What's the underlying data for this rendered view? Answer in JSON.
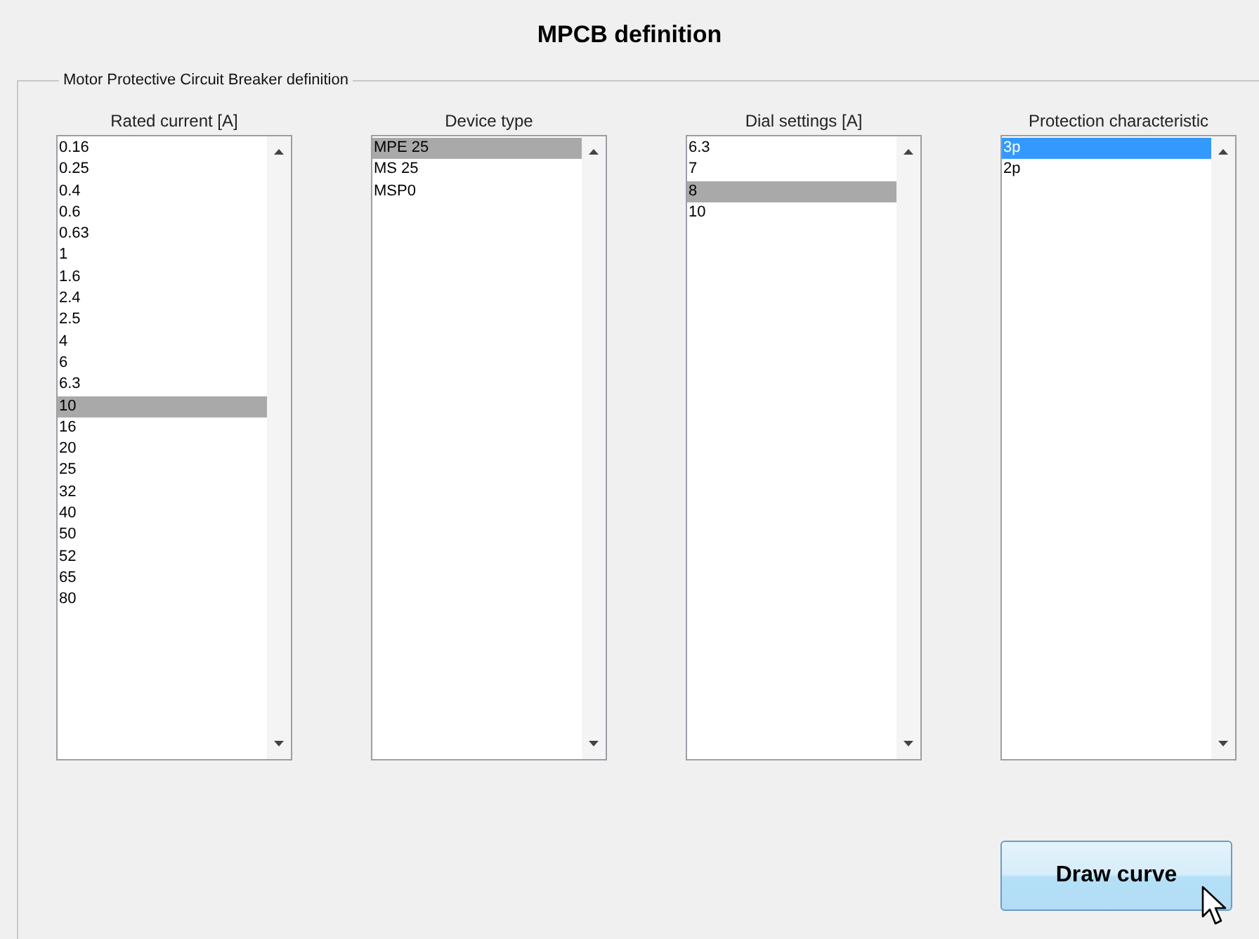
{
  "window": {
    "title": "MPCB definition"
  },
  "group": {
    "title": "Motor Protective Circuit Breaker definition"
  },
  "lists": [
    {
      "label": "Rated current [A]",
      "focused": false,
      "items": [
        {
          "text": "0.16",
          "selected": false
        },
        {
          "text": "0.25",
          "selected": false
        },
        {
          "text": "0.4",
          "selected": false
        },
        {
          "text": "0.6",
          "selected": false
        },
        {
          "text": "0.63",
          "selected": false
        },
        {
          "text": "1",
          "selected": false
        },
        {
          "text": "1.6",
          "selected": false
        },
        {
          "text": "2.4",
          "selected": false
        },
        {
          "text": "2.5",
          "selected": false
        },
        {
          "text": "4",
          "selected": false
        },
        {
          "text": "6",
          "selected": false
        },
        {
          "text": "6.3",
          "selected": false
        },
        {
          "text": "10",
          "selected": true
        },
        {
          "text": "16",
          "selected": false
        },
        {
          "text": "20",
          "selected": false
        },
        {
          "text": "25",
          "selected": false
        },
        {
          "text": "32",
          "selected": false
        },
        {
          "text": "40",
          "selected": false
        },
        {
          "text": "50",
          "selected": false
        },
        {
          "text": "52",
          "selected": false
        },
        {
          "text": "65",
          "selected": false
        },
        {
          "text": "80",
          "selected": false
        }
      ]
    },
    {
      "label": "Device type",
      "focused": false,
      "items": [
        {
          "text": "MPE 25",
          "selected": true
        },
        {
          "text": "MS 25",
          "selected": false
        },
        {
          "text": "MSP0",
          "selected": false
        }
      ]
    },
    {
      "label": "Dial settings [A]",
      "focused": false,
      "items": [
        {
          "text": "6.3",
          "selected": false
        },
        {
          "text": "7",
          "selected": false
        },
        {
          "text": "8",
          "selected": true
        },
        {
          "text": "10",
          "selected": false
        }
      ]
    },
    {
      "label": "Protection characteristic",
      "focused": true,
      "items": [
        {
          "text": "3p",
          "selected": true
        },
        {
          "text": "2p",
          "selected": false
        }
      ]
    }
  ],
  "button": {
    "label": "Draw curve"
  }
}
